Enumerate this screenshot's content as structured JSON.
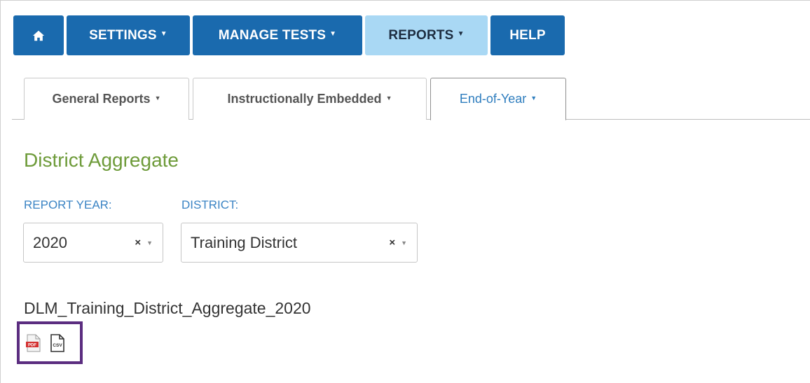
{
  "nav": {
    "home_icon": "home-icon",
    "settings": "SETTINGS",
    "manage_tests": "MANAGE TESTS",
    "reports": "REPORTS",
    "help": "HELP",
    "caret": "▼",
    "active_color": "#a9d8f4",
    "brand_color": "#1a6aae"
  },
  "tabs": [
    {
      "label": "General Reports",
      "active": false
    },
    {
      "label": "Instructionally Embedded",
      "active": false
    },
    {
      "label": "End-of-Year",
      "active": true
    }
  ],
  "page": {
    "title": "District Aggregate",
    "title_color": "#6e9b3a"
  },
  "filters": {
    "report_year_label": "REPORT YEAR:",
    "report_year_value": "2020",
    "district_label": "DISTRICT:",
    "district_value": "Training District",
    "clear_symbol": "×",
    "dropdown_caret": "▼"
  },
  "report": {
    "name": "DLM_Training_District_Aggregate_2020",
    "downloads": [
      {
        "icon": "pdf-file-icon",
        "text": "PDF"
      },
      {
        "icon": "csv-file-icon",
        "text": "CSV"
      }
    ],
    "highlight_color": "#5b2d80"
  }
}
